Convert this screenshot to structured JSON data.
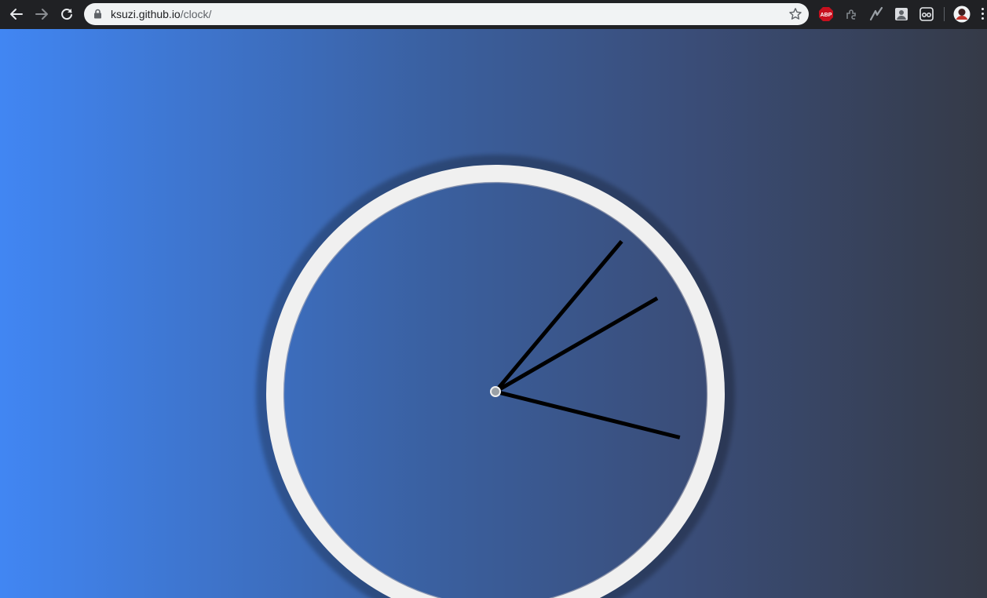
{
  "browser": {
    "url_host": "ksuzi.github.io",
    "url_path": "/clock/",
    "extensions": [
      {
        "icon": "adblock-plus-icon",
        "label": "ABP"
      },
      {
        "icon": "extension-puzzle-icon"
      },
      {
        "icon": "lightning-extension-icon"
      },
      {
        "icon": "photo-extension-icon"
      },
      {
        "icon": "glasses-extension-icon"
      }
    ]
  },
  "clock": {
    "hour_angle_deg": 104,
    "minute_angle_deg": 40,
    "second_angle_deg": 60,
    "face_color": "#f0f0f0",
    "hand_color": "#000000"
  }
}
